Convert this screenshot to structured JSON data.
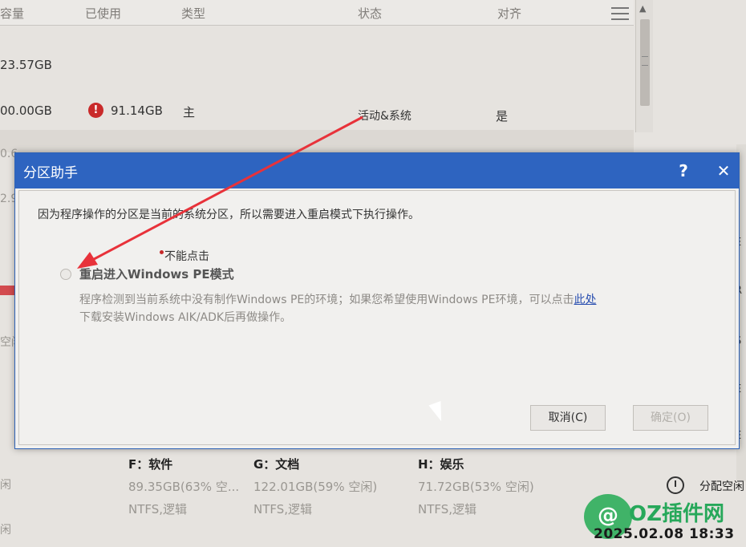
{
  "background": {
    "columns": [
      "容量",
      "已使用",
      "类型",
      "状态",
      "对齐"
    ],
    "rows": [
      {
        "capacity": "23.57GB"
      },
      {
        "capacity": "00.00GB",
        "used": "91.14GB",
        "type": "主",
        "status": "活动&系统",
        "aligned": "是"
      }
    ],
    "left_fragments": [
      "0.6",
      "2.9",
      "空闲",
      "闲",
      "闲"
    ],
    "right_fragments": [
      "E",
      "R",
      "S",
      "E",
      "E"
    ],
    "drives": [
      {
        "name": "F：软件",
        "size": "89.35GB(63% 空...",
        "fs": "NTFS,逻辑"
      },
      {
        "name": "G：文档",
        "size": "122.01GB(59% 空闲)",
        "fs": "NTFS,逻辑"
      },
      {
        "name": "H：娱乐",
        "size": "71.72GB(53% 空闲)",
        "fs": "NTFS,逻辑"
      }
    ],
    "alloc_label": "分配空闲",
    "watermark": "OZ插件网",
    "watermark_badge": "@",
    "timestamp": "2025.02.08  18:33"
  },
  "dialog": {
    "title": "分区助手",
    "help": "?",
    "close": "✕",
    "message": "因为程序操作的分区是当前的系统分区，所以需要进入重启模式下执行操作。",
    "note": "不能点击",
    "option_label": "重启进入Windows PE模式",
    "desc_line1": "程序检测到当前系统中没有制作Windows PE的环境；如果您希望使用Windows PE环境，可以点击",
    "desc_link": "此处",
    "desc_line2": "下载安装Windows AIK/ADK后再做操作。",
    "cancel_label": "取消(C)",
    "ok_label": "确定(O)"
  },
  "colors": {
    "titlebar": "#2e64c0",
    "arrow": "#e8323a",
    "link": "#2a4fb0"
  }
}
